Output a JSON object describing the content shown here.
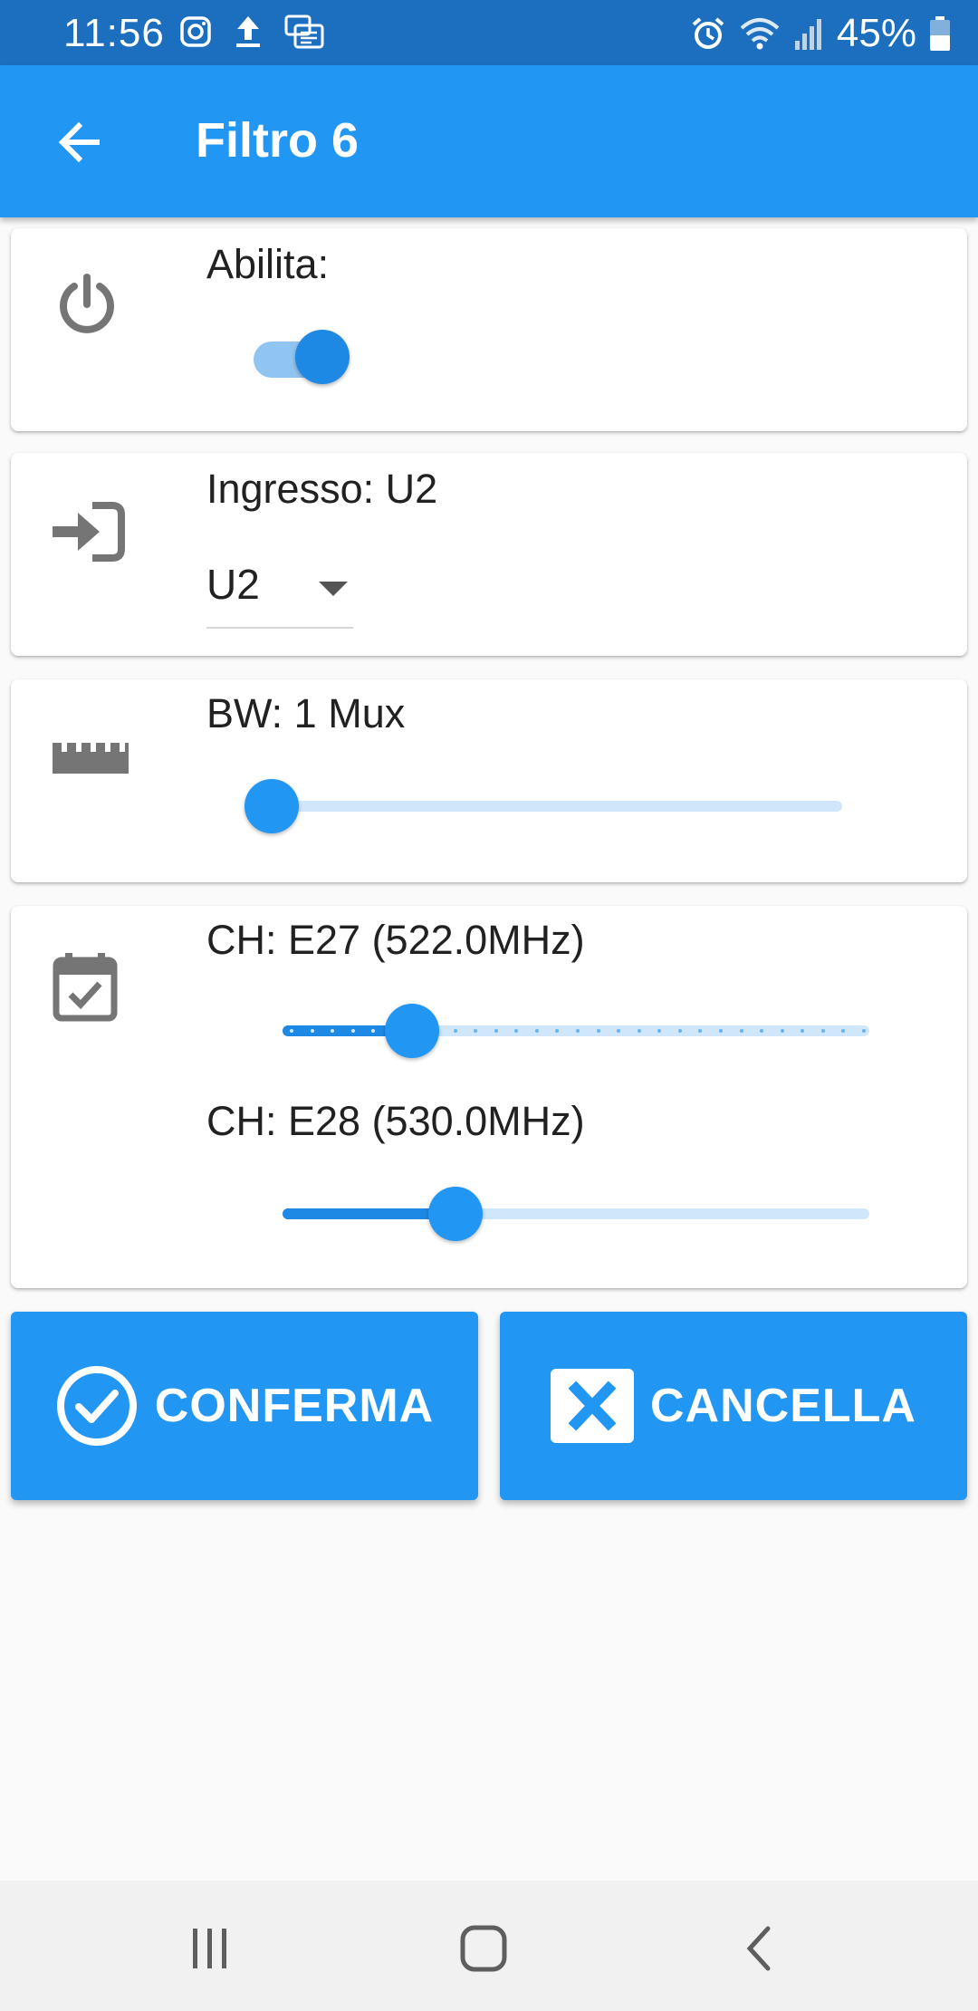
{
  "status_bar": {
    "time": "11:56",
    "battery": "45%",
    "icons_left": [
      "instagram-icon",
      "upload-icon",
      "sim-card-icon"
    ],
    "icons_right": [
      "alarm-icon",
      "wifi-icon",
      "signal-icon",
      "battery-icon"
    ]
  },
  "app_bar": {
    "title": "Filtro 6",
    "back_icon": "arrow-back-icon"
  },
  "enable_card": {
    "icon": "power-icon",
    "label": "Abilita:",
    "toggle_on": true
  },
  "input_card": {
    "icon": "login-arrow-icon",
    "label": "Ingresso: U2",
    "selected": "U2"
  },
  "bw_card": {
    "icon": "ruler-icon",
    "label": "BW: 1 Mux",
    "value_fraction": 0.0
  },
  "channel_card": {
    "icon": "calendar-check-icon",
    "ch1_label": "CH: E27 (522.0MHz)",
    "ch1_fraction": 0.22,
    "ch2_label": "CH: E28 (530.0MHz)",
    "ch2_fraction": 0.295
  },
  "buttons": {
    "confirm": "CONFERMA",
    "cancel": "CANCELLA"
  },
  "colors": {
    "status_bar": "#1c6fbf",
    "primary": "#2196f3",
    "active_track": "#1e88e5",
    "inactive_track": "#cfe6fb",
    "icon_grey": "#757575"
  },
  "nav_bar": [
    "recent-apps-icon",
    "home-icon",
    "back-icon"
  ]
}
